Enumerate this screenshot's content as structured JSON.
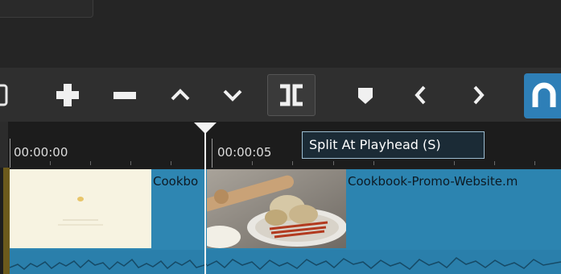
{
  "toolbar": {
    "buttons": [
      {
        "id": "add",
        "icon": "plus-icon"
      },
      {
        "id": "remove",
        "icon": "minus-icon"
      },
      {
        "id": "move-up",
        "icon": "chevron-up-icon"
      },
      {
        "id": "move-down",
        "icon": "chevron-down-icon"
      },
      {
        "id": "split",
        "icon": "split-icon",
        "active": true
      },
      {
        "id": "marker",
        "icon": "marker-icon"
      },
      {
        "id": "previous-marker",
        "icon": "chevron-left-icon"
      },
      {
        "id": "next-marker",
        "icon": "chevron-right-icon"
      },
      {
        "id": "snap",
        "icon": "magnet-icon",
        "active": true
      }
    ]
  },
  "tooltip": {
    "text": "Split At Playhead (S)"
  },
  "ruler": {
    "labels": [
      "00:00:00",
      "00:00:05"
    ]
  },
  "clips": [
    {
      "title": "Cookbo"
    },
    {
      "title": "Cookbook-Promo-Website.m"
    }
  ],
  "colors": {
    "accent": "#2e7fb7",
    "clip": "#2e86b2",
    "tooltip_bg": "#1b2b36",
    "playhead": "#f2f2f2"
  }
}
